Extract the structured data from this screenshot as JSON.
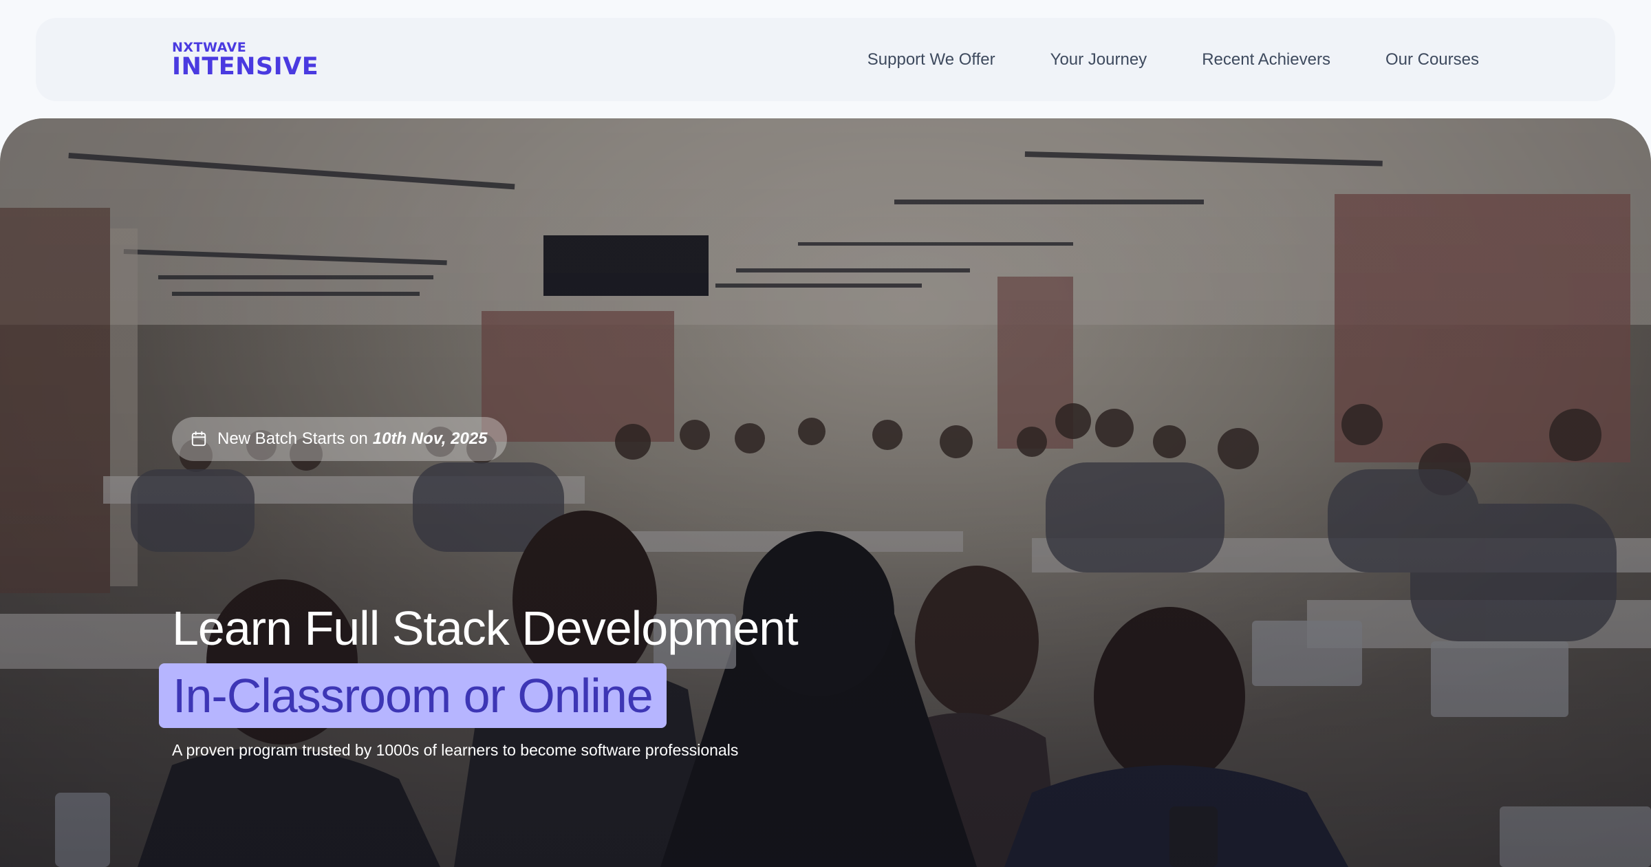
{
  "brand": {
    "logo_top": "NXTWAVE",
    "logo_bottom": "INTENSIVE",
    "color": "#4a3ae0"
  },
  "nav": {
    "items": [
      {
        "label": "Support We Offer"
      },
      {
        "label": "Your Journey"
      },
      {
        "label": "Recent Achievers"
      },
      {
        "label": "Our Courses"
      }
    ]
  },
  "hero": {
    "batch_prefix": "New Batch Starts on",
    "batch_date": "10th Nov, 2025",
    "batch_icon": "calendar-icon",
    "title": "Learn Full Stack Development",
    "highlight": "In-Classroom or Online",
    "subtitle": "A proven program trusted by 1000s of learners to become software professionals",
    "highlight_bg": "#b6b5ff",
    "highlight_color": "#3d36b5",
    "background_image": "classroom-photo"
  }
}
